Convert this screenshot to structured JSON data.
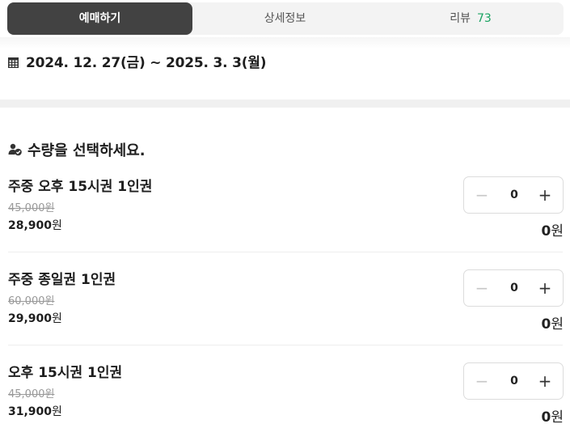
{
  "tabs": [
    {
      "label": "예매하기",
      "count": ""
    },
    {
      "label": "상세정보",
      "count": ""
    },
    {
      "label": "리뷰",
      "count": "73"
    }
  ],
  "colors": {
    "tab_active_bg": "#424242",
    "review_count": "#1aa362"
  },
  "schedule": {
    "icon": "calendar-icon",
    "date_range": "2024. 12. 27(금) ~ 2025. 3. 3(월)"
  },
  "quantity_section": {
    "icon": "people-check-icon",
    "title": "수량을 선택하세요."
  },
  "items": [
    {
      "name": "주중 오후 15시권 1인권",
      "original_price": "45,000원",
      "sale_price": "28,900",
      "currency": "원",
      "quantity": "0",
      "total": "0",
      "total_currency": "원"
    },
    {
      "name": "주중 종일권 1인권",
      "original_price": "60,000원",
      "sale_price": "29,900",
      "currency": "원",
      "quantity": "0",
      "total": "0",
      "total_currency": "원"
    },
    {
      "name": "오후 15시권 1인권",
      "original_price": "45,000원",
      "sale_price": "31,900",
      "currency": "원",
      "quantity": "0",
      "total": "0",
      "total_currency": "원"
    }
  ],
  "stepper": {
    "minus": "−",
    "plus": "+"
  }
}
